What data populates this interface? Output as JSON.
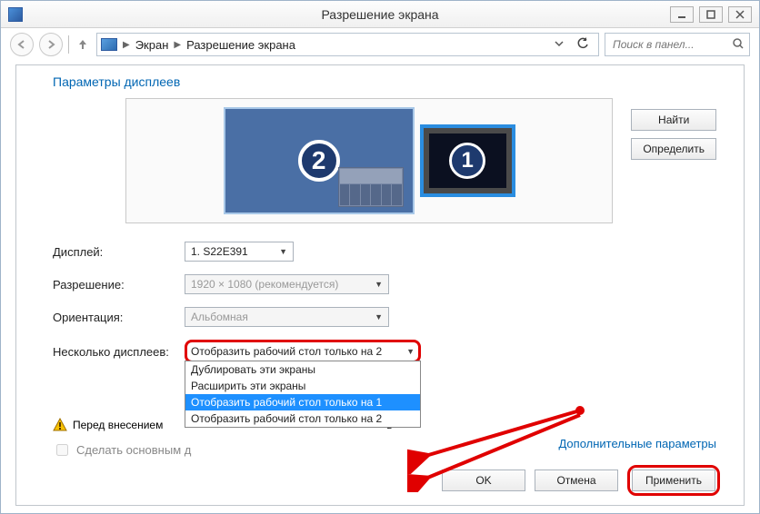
{
  "window": {
    "title": "Разрешение экрана"
  },
  "breadcrumb": {
    "root": "Экран",
    "current": "Разрешение экрана"
  },
  "search": {
    "placeholder": "Поиск в панел..."
  },
  "page": {
    "heading": "Параметры дисплеев",
    "find_button": "Найти",
    "identify_button": "Определить",
    "advanced_link": "Дополнительные параметры"
  },
  "monitors": {
    "primary_num": "1",
    "secondary_num": "2"
  },
  "form": {
    "display_label": "Дисплей:",
    "display_value": "1. S22E391",
    "resolution_label": "Разрешение:",
    "resolution_value": "1920 × 1080 (рекомендуется)",
    "orientation_label": "Ориентация:",
    "orientation_value": "Альбомная",
    "multi_label": "Несколько дисплеев:",
    "multi_value": "Отобразить рабочий стол только на 2",
    "multi_options": [
      "Дублировать эти экраны",
      "Расширить эти экраны",
      "Отобразить рабочий стол только на 1",
      "Отобразить рабочий стол только на 2"
    ],
    "multi_selected_index": 2
  },
  "warning": {
    "prefix": "Перед внесением",
    "truncated_tail": "ь\""
  },
  "checkbox": {
    "label": "Сделать основным д"
  },
  "footer": {
    "ok": "OK",
    "cancel": "Отмена",
    "apply": "Применить"
  }
}
